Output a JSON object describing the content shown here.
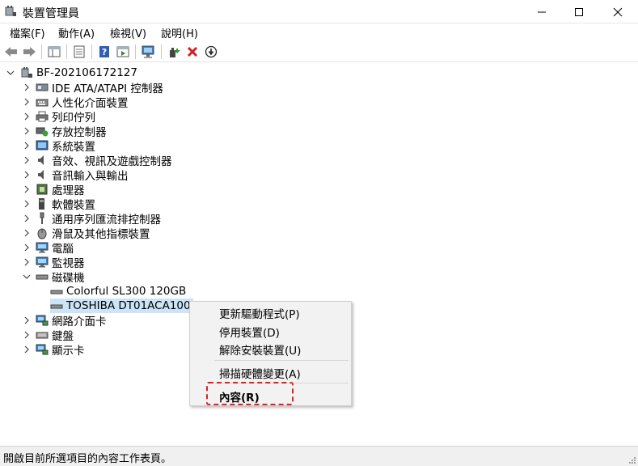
{
  "window": {
    "title": "裝置管理員",
    "controls": {
      "minimize": "minimize-icon",
      "maximize": "maximize-icon",
      "close": "close-icon"
    }
  },
  "menu": [
    {
      "label": "檔案(F)"
    },
    {
      "label": "動作(A)"
    },
    {
      "label": "檢視(V)"
    },
    {
      "label": "說明(H)"
    }
  ],
  "toolbar": [
    "back-icon",
    "forward-icon",
    "console-tree-icon",
    "properties-icon",
    "help-icon",
    "action-pane-icon",
    "scan-hardware-icon",
    "update-driver-icon",
    "uninstall-icon",
    "disable-icon"
  ],
  "tree": {
    "root": "BF-202106172127",
    "categories": [
      {
        "label": "IDE ATA/ATAPI 控制器",
        "icon": "ide-controller-icon"
      },
      {
        "label": "人性化介面裝置",
        "icon": "hid-icon"
      },
      {
        "label": "列印佇列",
        "icon": "printer-icon"
      },
      {
        "label": "存放控制器",
        "icon": "storage-controller-icon"
      },
      {
        "label": "系統裝置",
        "icon": "system-devices-icon"
      },
      {
        "label": "音效、視訊及遊戲控制器",
        "icon": "speaker-icon"
      },
      {
        "label": "音訊輸入與輸出",
        "icon": "audio-io-icon"
      },
      {
        "label": "處理器",
        "icon": "processor-icon"
      },
      {
        "label": "軟體裝置",
        "icon": "software-device-icon"
      },
      {
        "label": "通用序列匯流排控制器",
        "icon": "usb-icon"
      },
      {
        "label": "滑鼠及其他指標裝置",
        "icon": "mouse-icon"
      },
      {
        "label": "電腦",
        "icon": "computer-icon"
      },
      {
        "label": "監視器",
        "icon": "monitor-icon"
      },
      {
        "label": "磁碟機",
        "icon": "disk-drive-icon"
      },
      {
        "label": "網路介面卡",
        "icon": "network-adapter-icon"
      },
      {
        "label": "鍵盤",
        "icon": "keyboard-icon"
      },
      {
        "label": "顯示卡",
        "icon": "display-adapter-icon"
      }
    ],
    "disk_children": [
      {
        "label": "Colorful SL300 120GB"
      },
      {
        "label": "TOSHIBA DT01ACA100"
      }
    ]
  },
  "context_menu": {
    "items": [
      {
        "label": "更新驅動程式(P)"
      },
      {
        "label": "停用裝置(D)"
      },
      {
        "label": "解除安裝裝置(U)"
      },
      {
        "label": "掃描硬體變更(A)"
      },
      {
        "label": "內容(R)"
      }
    ]
  },
  "status": {
    "text": "開啟目前所選項目的內容工作表頁。"
  },
  "colors": {
    "selection": "#cce4f7",
    "highlight_border": "#e02020",
    "menu_bg": "#f2f2f2"
  }
}
